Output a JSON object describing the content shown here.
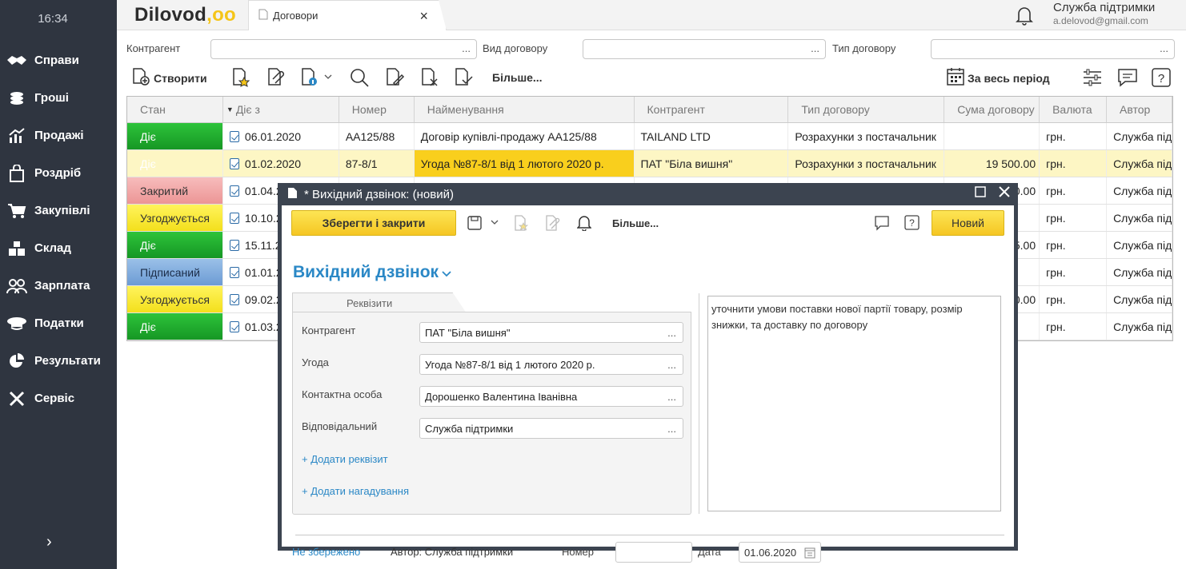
{
  "clock": "16:34",
  "sidebar": {
    "items": [
      {
        "label": "Справи",
        "icon": "handshake-icon"
      },
      {
        "label": "Гроші",
        "icon": "coins-icon"
      },
      {
        "label": "Продажі",
        "icon": "chart-icon"
      },
      {
        "label": "Роздріб",
        "icon": "shopping-bag-icon"
      },
      {
        "label": "Закупівлі",
        "icon": "cart-icon"
      },
      {
        "label": "Склад",
        "icon": "boxes-icon"
      },
      {
        "label": "Зарплата",
        "icon": "people-icon"
      },
      {
        "label": "Податки",
        "icon": "officer-cap-icon"
      },
      {
        "label": "Результати",
        "icon": "pie-chart-icon"
      },
      {
        "label": "Сервіс",
        "icon": "tools-icon"
      }
    ],
    "expand": "›"
  },
  "header": {
    "logo": "Dilovod",
    "logo_dots": ",oo",
    "tab_title": "Договори",
    "tab_close": "×",
    "user_name": "Служба підтримки",
    "user_email": "a.delovod@gmail.com"
  },
  "filters": {
    "counterparty_label": "Контрагент",
    "contract_kind_label": "Вид договору",
    "contract_type_label": "Тип договору",
    "dots": "..."
  },
  "toolbar": {
    "create_label": "Створити",
    "more_label": "Більше...",
    "period_label": "За весь період"
  },
  "table": {
    "columns": [
      "Стан",
      "Діє з",
      "Номер",
      "Найменування",
      "Контрагент",
      "Тип договору",
      "Сума договору",
      "Валюта",
      "Автор"
    ],
    "rows": [
      {
        "status": "Діє",
        "cls": "st-green",
        "date": "06.01.2020",
        "num": "AA125/88",
        "name": "Договір купівлі-продажу AA125/88",
        "cp": "TAILAND LTD",
        "type": "Розрахунки з постачальник",
        "sum": "",
        "cur": "грн.",
        "author": "Служба під"
      },
      {
        "status": "Діє",
        "cls": "st-sel",
        "date": "01.02.2020",
        "num": "87-8/1",
        "name": "Угода №87-8/1 від 1 лютого 2020 р.",
        "cp": "ПАТ \"Біла вишня\"",
        "type": "Розрахунки з постачальник",
        "sum": "19 500.00",
        "cur": "грн.",
        "author": "Служба під",
        "selected": true
      },
      {
        "status": "Закритий",
        "cls": "st-pink",
        "date": "01.04.2",
        "num": "",
        "name": "",
        "cp": "",
        "type": "",
        "sum": "0.00",
        "cur": "грн.",
        "author": "Служба під"
      },
      {
        "status": "Узгоджується",
        "cls": "st-yellow",
        "date": "10.10.2",
        "num": "",
        "name": "",
        "cp": "",
        "type": "",
        "sum": "",
        "cur": "грн.",
        "author": "Служба під"
      },
      {
        "status": "Діє",
        "cls": "st-green",
        "date": "15.11.2",
        "num": "",
        "name": "",
        "cp": "",
        "type": "",
        "sum": "5.00",
        "cur": "грн.",
        "author": "Служба під"
      },
      {
        "status": "Підписаний",
        "cls": "st-blue",
        "date": "01.01.20",
        "num": "",
        "name": "",
        "cp": "",
        "type": "",
        "sum": "",
        "cur": "грн.",
        "author": "Служба під"
      },
      {
        "status": "Узгоджується",
        "cls": "st-yellow",
        "date": "09.02.2",
        "num": "",
        "name": "",
        "cp": "",
        "type": "",
        "sum": "0.00",
        "cur": "грн.",
        "author": "Служба під"
      },
      {
        "status": "Діє",
        "cls": "st-green",
        "date": "01.03.20",
        "num": "",
        "name": "",
        "cp": "",
        "type": "",
        "sum": "",
        "cur": "грн.",
        "author": "Служба під"
      }
    ]
  },
  "modal": {
    "title": "* Вихідний дзвінок: (новий)",
    "save_close": "Зберегти і закрити",
    "more": "Більше...",
    "new_btn": "Новий",
    "heading": "Вихідний дзвінок",
    "tab": "Реквізити",
    "fields": [
      {
        "label": "Контрагент",
        "value": "ПАТ \"Біла вишня\""
      },
      {
        "label": "Угода",
        "value": "Угода №87-8/1 від 1 лютого 2020 р."
      },
      {
        "label": "Контактна особа",
        "value": "Дорошенко Валентина Іванівна"
      },
      {
        "label": "Відповідальний",
        "value": "Служба підтримки"
      }
    ],
    "add_attr": "+ Додати реквізит",
    "add_reminder": "+ Додати нагадування",
    "note": "уточнити умови поставки нової партії товару, розмір знижки, та доставку по договору",
    "not_saved": "Не збережено",
    "author": "Автор: Служба підтримки",
    "number_label": "Номер",
    "number_value": "",
    "date_label": "Дата",
    "date_value": "01.06.2020"
  },
  "colors": {
    "sidebar": "#2f3540",
    "accent_yellow": "#f5c623",
    "link_blue": "#2b88c6",
    "status_green": "#169724"
  }
}
